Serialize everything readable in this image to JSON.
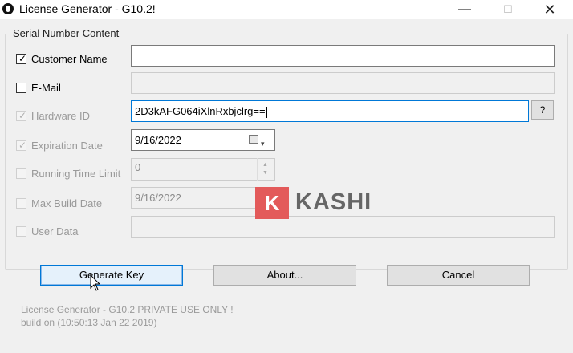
{
  "window": {
    "title": "License Generator - G10.2!",
    "minimize_glyph": "—",
    "maximize_glyph": "☐",
    "close_glyph": "✕"
  },
  "group": {
    "title": "Serial Number Content"
  },
  "fields": {
    "customer_name": {
      "label": "Customer Name",
      "checked": true,
      "enabled": true,
      "value": ""
    },
    "email": {
      "label": "E-Mail",
      "checked": false,
      "enabled": true,
      "value": ""
    },
    "hardware_id": {
      "label": "Hardware ID",
      "checked": true,
      "enabled": false,
      "value": "2D3kAFG064iXlnRxbjclrg=="
    },
    "expiration_date": {
      "label": "Expiration Date",
      "checked": true,
      "enabled": false,
      "value": "9/16/2022"
    },
    "running_time_limit": {
      "label": "Running Time Limit",
      "checked": false,
      "enabled": false,
      "value": "0"
    },
    "max_build_date": {
      "label": "Max Build Date",
      "checked": false,
      "enabled": false,
      "value": "9/16/2022"
    },
    "user_data": {
      "label": "User Data",
      "checked": false,
      "enabled": false,
      "value": ""
    }
  },
  "help_button": "?",
  "buttons": {
    "generate_key": "Generate Key",
    "about": "About...",
    "cancel": "Cancel"
  },
  "footer": {
    "line1": "License Generator - G10.2 PRIVATE USE ONLY !",
    "line2": "build on (10:50:13 Jan 22 2019)"
  },
  "watermark": {
    "badge": "K",
    "text": "KASHI"
  },
  "icons": {
    "check": "✓",
    "calendar": "calendar-icon",
    "dropdown_arrow": "▾",
    "spin_up": "▲",
    "spin_down": "▼"
  },
  "colors": {
    "focus_border": "#0078d7",
    "watermark_badge": "#e35a5a"
  }
}
